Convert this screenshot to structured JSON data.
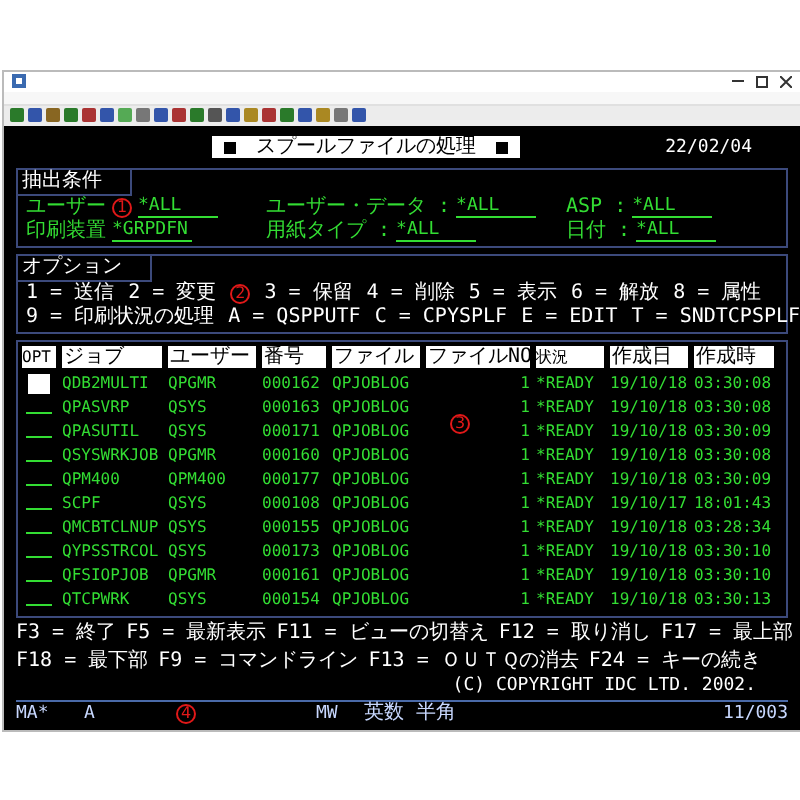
{
  "screen": {
    "title": "スプールファイルの処理",
    "date": "22/02/04"
  },
  "filters": {
    "label": "抽出条件",
    "rows": [
      [
        {
          "label": "ユーザー",
          "value": "*ALL",
          "marker": "1"
        },
        {
          "label": "ユーザー・データ :",
          "value": "*ALL"
        },
        {
          "label": "ASP :",
          "value": "*ALL"
        }
      ],
      [
        {
          "label": "印刷装置",
          "value": "*GRPDFN"
        },
        {
          "label": "用紙タイプ :",
          "value": "*ALL"
        },
        {
          "label": "日付 :",
          "value": "*ALL"
        }
      ]
    ]
  },
  "options": {
    "label": "オプション",
    "lines": [
      [
        {
          "text": "1 = 送信"
        },
        {
          "text": "2 = 変更",
          "marker": "2"
        },
        {
          "text": "3 = 保留"
        },
        {
          "text": "4 = 削除"
        },
        {
          "text": "5 = 表示"
        },
        {
          "text": "6 = 解放"
        },
        {
          "text": "8 = 属性"
        }
      ],
      [
        {
          "text": "9 = 印刷状況の処理"
        },
        {
          "text": "A = QSPPUTF"
        },
        {
          "text": "C = CPYSPLF"
        },
        {
          "text": "E = EDIT"
        },
        {
          "text": "T = SNDTCPSPLF"
        }
      ]
    ]
  },
  "table": {
    "marker": "3",
    "opt_column": "OPT",
    "columns": [
      "ジョブ",
      "ユーザー",
      "番号",
      "ファイル",
      "ファイルNO",
      "状況",
      "作成日",
      "作成時"
    ],
    "rows": [
      {
        "cursor": true,
        "cells": [
          "QDB2MULTI",
          "QPGMR",
          "000162",
          "QPJOBLOG",
          "1",
          "*READY",
          "19/10/18",
          "03:30:08"
        ]
      },
      {
        "cursor": false,
        "cells": [
          "QPASVRP",
          "QSYS",
          "000163",
          "QPJOBLOG",
          "1",
          "*READY",
          "19/10/18",
          "03:30:08"
        ]
      },
      {
        "cursor": false,
        "cells": [
          "QPASUTIL",
          "QSYS",
          "000171",
          "QPJOBLOG",
          "1",
          "*READY",
          "19/10/18",
          "03:30:09"
        ]
      },
      {
        "cursor": false,
        "cells": [
          "QSYSWRKJOB",
          "QPGMR",
          "000160",
          "QPJOBLOG",
          "1",
          "*READY",
          "19/10/18",
          "03:30:08"
        ]
      },
      {
        "cursor": false,
        "cells": [
          "QPM400",
          "QPM400",
          "000177",
          "QPJOBLOG",
          "1",
          "*READY",
          "19/10/18",
          "03:30:09"
        ]
      },
      {
        "cursor": false,
        "cells": [
          "SCPF",
          "QSYS",
          "000108",
          "QPJOBLOG",
          "1",
          "*READY",
          "19/10/17",
          "18:01:43"
        ]
      },
      {
        "cursor": false,
        "cells": [
          "QMCBTCLNUP",
          "QSYS",
          "000155",
          "QPJOBLOG",
          "1",
          "*READY",
          "19/10/18",
          "03:28:34"
        ]
      },
      {
        "cursor": false,
        "cells": [
          "QYPSSTRCOL",
          "QSYS",
          "000173",
          "QPJOBLOG",
          "1",
          "*READY",
          "19/10/18",
          "03:30:10"
        ]
      },
      {
        "cursor": false,
        "cells": [
          "QFSIOPJOB",
          "QPGMR",
          "000161",
          "QPJOBLOG",
          "1",
          "*READY",
          "19/10/18",
          "03:30:10"
        ]
      },
      {
        "cursor": false,
        "cells": [
          "QTCPWRK",
          "QSYS",
          "000154",
          "QPJOBLOG",
          "1",
          "*READY",
          "19/10/18",
          "03:30:13"
        ]
      }
    ]
  },
  "function_keys": [
    [
      "F3 = 終了",
      "F5 = 最新表示",
      "F11 = ビューの切替え",
      "F12 = 取り消し",
      "F17 = 最上部"
    ],
    [
      "F18 = 最下部",
      "F9 = コマンドライン",
      "F13 = ＯＵＴＱの消去",
      "F24 = キーの続き"
    ]
  ],
  "copyright": "(C) COPYRIGHT IDC LTD. 2002.",
  "status_bar": {
    "items": [
      {
        "text": "MA*"
      },
      {
        "text": "A",
        "marker": "4"
      },
      {
        "text": "MW"
      },
      {
        "text": "英数 半角"
      },
      {
        "text": "11/003"
      }
    ]
  }
}
